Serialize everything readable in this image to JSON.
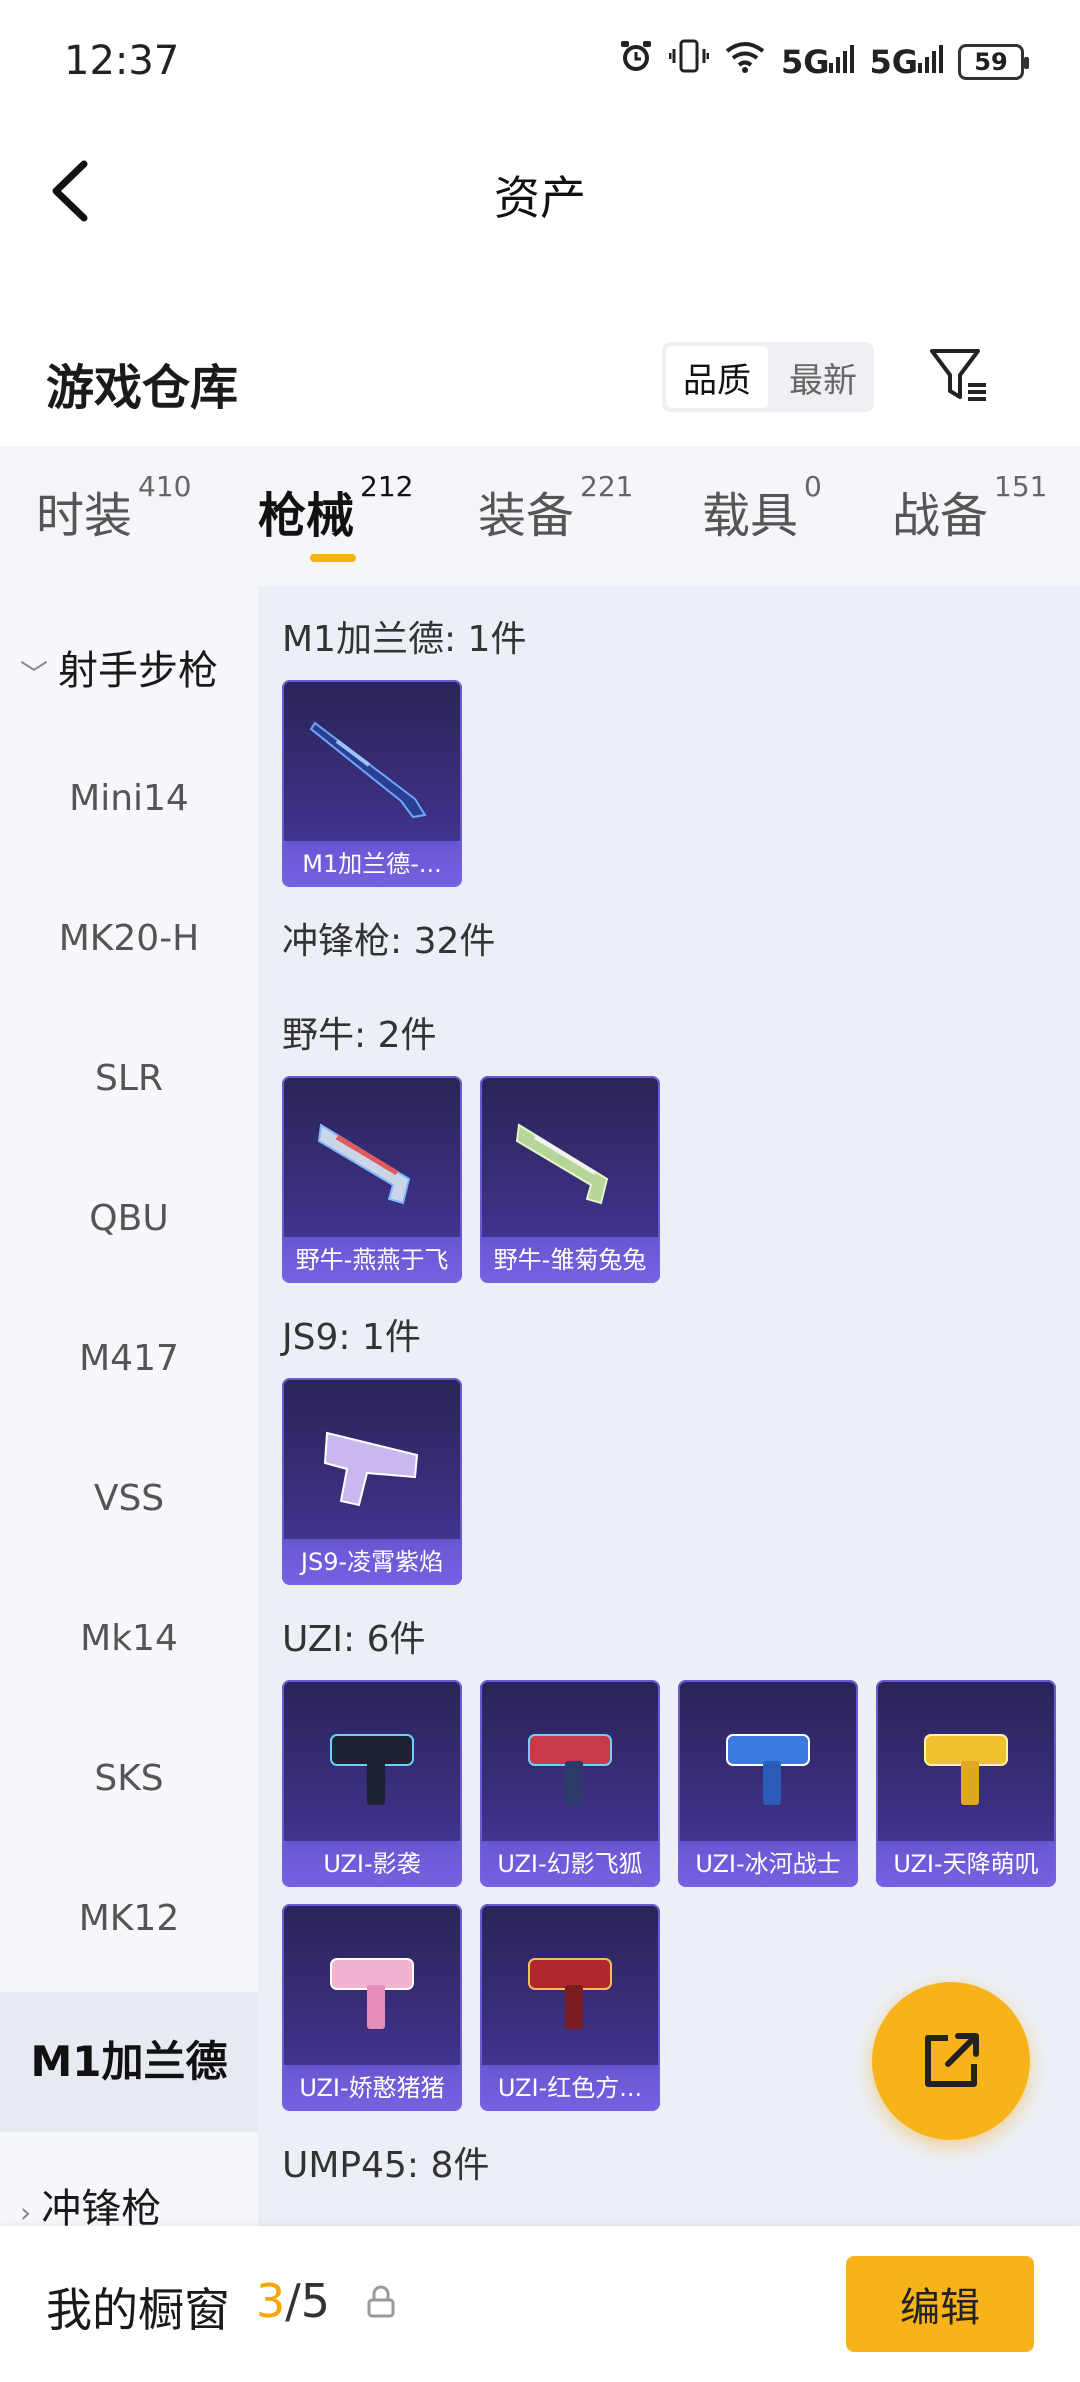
{
  "status_bar": {
    "time": "12:37",
    "battery": "59",
    "signal_1": "5G",
    "signal_2": "5G"
  },
  "header": {
    "title": "资产"
  },
  "warehouse": {
    "title": "游戏仓库",
    "sort_options": [
      "品质",
      "最新"
    ],
    "sort_selected": "品质"
  },
  "tabs": [
    {
      "label": "时装",
      "count": "410",
      "active": false
    },
    {
      "label": "枪械",
      "count": "212",
      "active": true
    },
    {
      "label": "装备",
      "count": "221",
      "active": false
    },
    {
      "label": "载具",
      "count": "0",
      "active": false
    },
    {
      "label": "战备",
      "count": "151",
      "active": false
    }
  ],
  "side_list": {
    "group_top": "射手步枪",
    "items": [
      "Mini14",
      "MK20-H",
      "SLR",
      "QBU",
      "M417",
      "VSS",
      "Mk14",
      "SKS",
      "MK12"
    ],
    "selected": "M1加兰德",
    "group_bottom": "冲锋枪"
  },
  "sections": [
    {
      "title": "M1加兰德: 1件",
      "cards": [
        "M1加兰德-..."
      ]
    },
    {
      "title": "冲锋枪: 32件",
      "cards": []
    },
    {
      "title": "野牛: 2件",
      "cards": [
        "野牛-燕燕于飞",
        "野牛-雏菊兔兔"
      ]
    },
    {
      "title": "JS9: 1件",
      "cards": [
        "JS9-凌霄紫焰"
      ]
    },
    {
      "title": "UZI: 6件",
      "cards": [
        "UZI-影袭",
        "UZI-幻影飞狐",
        "UZI-冰河战士",
        "UZI-天降萌叽",
        "UZI-娇憨猪猪",
        "UZI-红色方..."
      ]
    },
    {
      "title": "UMP45: 8件",
      "cards": []
    }
  ],
  "bottom_bar": {
    "title": "我的橱窗",
    "current": "3",
    "total": "/5",
    "edit_label": "编辑"
  },
  "colors": {
    "accent": "#f9b31a",
    "card_bg": "#3b2f80"
  }
}
